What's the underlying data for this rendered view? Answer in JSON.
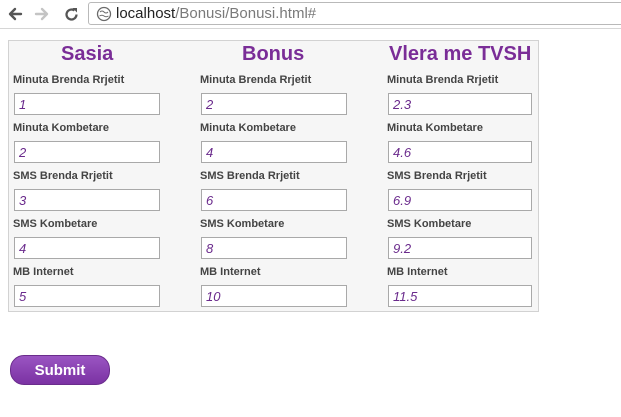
{
  "browser": {
    "url_host": "localhost",
    "url_path": "/Bonusi/Bonusi.html#"
  },
  "form": {
    "columns": [
      {
        "title": "Sasia",
        "fields": [
          {
            "label": "Minuta Brenda Rrjetit",
            "value": "1"
          },
          {
            "label": "Minuta Kombetare",
            "value": "2"
          },
          {
            "label": "SMS Brenda Rrjetit",
            "value": "3"
          },
          {
            "label": "SMS Kombetare",
            "value": "4"
          },
          {
            "label": "MB Internet",
            "value": "5"
          }
        ]
      },
      {
        "title": "Bonus",
        "fields": [
          {
            "label": "Minuta Brenda Rrjetit",
            "value": "2"
          },
          {
            "label": "Minuta Kombetare",
            "value": "4"
          },
          {
            "label": "SMS Brenda Rrjetit",
            "value": "6"
          },
          {
            "label": "SMS Kombetare",
            "value": "8"
          },
          {
            "label": "MB Internet",
            "value": "10"
          }
        ]
      },
      {
        "title": "Vlera me TVSH",
        "fields": [
          {
            "label": "Minuta Brenda Rrjetit",
            "value": "2.3"
          },
          {
            "label": "Minuta Kombetare",
            "value": "4.6"
          },
          {
            "label": "SMS Brenda Rrjetit",
            "value": "6.9"
          },
          {
            "label": "SMS Kombetare",
            "value": "9.2"
          },
          {
            "label": "MB Internet",
            "value": "11.5"
          }
        ]
      }
    ],
    "submit_label": "Submit"
  },
  "colors": {
    "accent": "#7a2d97",
    "input_text": "#6a2a8c",
    "panel_bg": "#f6f6f6"
  },
  "icons": [
    "back-arrow-icon",
    "forward-arrow-icon",
    "reload-icon",
    "page-icon"
  ]
}
